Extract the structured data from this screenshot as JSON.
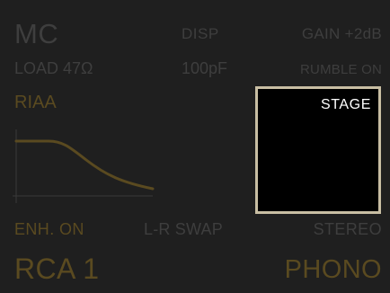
{
  "top_row": {
    "cartridge": "MC",
    "display": "DISP",
    "gain": "GAIN +2dB"
  },
  "second_row": {
    "load": "LOAD 47Ω",
    "capacitance": "100pF",
    "rumble": "RUMBLE ON"
  },
  "eq_curve": {
    "label": "RIAA"
  },
  "stage_panel": {
    "label": "STAGE"
  },
  "bottom_row": {
    "enhancement": "ENH. ON",
    "channel_swap": "L-R SWAP",
    "stereo": "STEREO"
  },
  "footer": {
    "input": "RCA 1",
    "source": "PHONO"
  },
  "colors": {
    "background": "#1f1f1f",
    "dim_text": "#3e3e3e",
    "gold_text": "#5a4a20",
    "curve": "#5a4a20",
    "panel_border": "#c8bea3",
    "panel_fill": "#000000",
    "panel_text": "#ffffff"
  }
}
